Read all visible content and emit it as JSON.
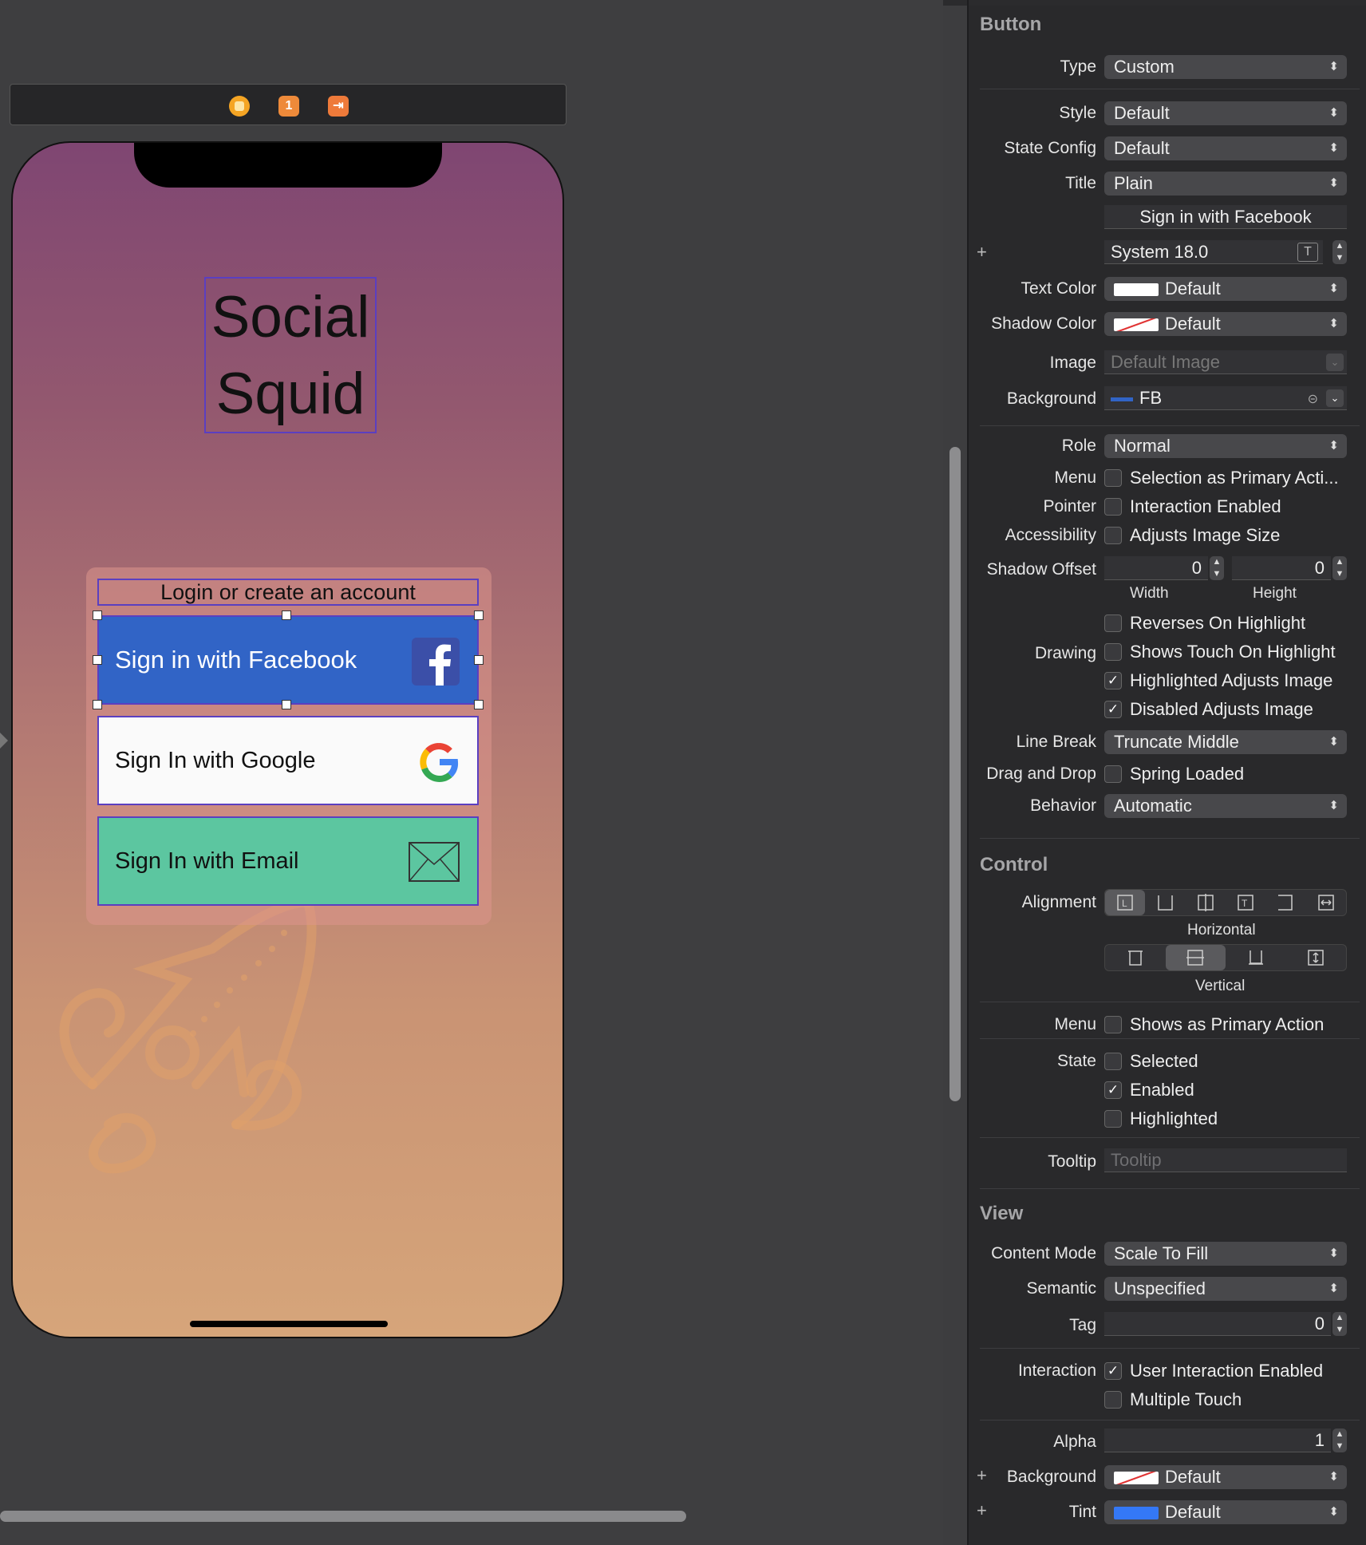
{
  "scene": {
    "title_line1": "Social",
    "title_line2": "Squid",
    "login_label": "Login or create an account",
    "facebook_label": "Sign in with Facebook",
    "google_label": "Sign In with Google",
    "email_label": "Sign In with Email",
    "scene_badge": "1"
  },
  "inspector": {
    "button": {
      "header": "Button",
      "type_label": "Type",
      "type_value": "Custom",
      "style_label": "Style",
      "style_value": "Default",
      "state_config_label": "State Config",
      "state_config_value": "Default",
      "title_label": "Title",
      "title_value": "Plain",
      "title_text": "Sign in with Facebook",
      "font_value": "System 18.0",
      "text_color_label": "Text Color",
      "text_color_value": "Default",
      "shadow_color_label": "Shadow Color",
      "shadow_color_value": "Default",
      "image_label": "Image",
      "image_placeholder": "Default Image",
      "background_label": "Background",
      "background_value": "FB",
      "role_label": "Role",
      "role_value": "Normal",
      "menu_label": "Menu",
      "menu_option": "Selection as Primary Acti...",
      "pointer_label": "Pointer",
      "pointer_option": "Interaction Enabled",
      "accessibility_label": "Accessibility",
      "accessibility_option": "Adjusts Image Size",
      "shadow_offset_label": "Shadow Offset",
      "shadow_width": "0",
      "shadow_height": "0",
      "width_label": "Width",
      "height_label": "Height",
      "reverses_option": "Reverses On Highlight",
      "drawing_label": "Drawing",
      "shows_touch_option": "Shows Touch On Highlight",
      "highlighted_adjusts_option": "Highlighted Adjusts Image",
      "disabled_adjusts_option": "Disabled Adjusts Image",
      "line_break_label": "Line Break",
      "line_break_value": "Truncate Middle",
      "drag_drop_label": "Drag and Drop",
      "drag_drop_option": "Spring Loaded",
      "behavior_label": "Behavior",
      "behavior_value": "Automatic"
    },
    "control": {
      "header": "Control",
      "alignment_label": "Alignment",
      "horizontal_label": "Horizontal",
      "vertical_label": "Vertical",
      "menu_label": "Menu",
      "menu_option": "Shows as Primary Action",
      "state_label": "State",
      "selected_option": "Selected",
      "enabled_option": "Enabled",
      "highlighted_option": "Highlighted",
      "tooltip_label": "Tooltip",
      "tooltip_placeholder": "Tooltip"
    },
    "view": {
      "header": "View",
      "content_mode_label": "Content Mode",
      "content_mode_value": "Scale To Fill",
      "semantic_label": "Semantic",
      "semantic_value": "Unspecified",
      "tag_label": "Tag",
      "tag_value": "0",
      "interaction_label": "Interaction",
      "user_interaction_option": "User Interaction Enabled",
      "multiple_touch_option": "Multiple Touch",
      "alpha_label": "Alpha",
      "alpha_value": "1",
      "background_label": "Background",
      "background_value": "Default",
      "tint_label": "Tint",
      "tint_value": "Default"
    }
  },
  "colors": {
    "fb_blue": "#3164c6",
    "email_green": "#5cc6a0",
    "selection": "#5b3fc0"
  }
}
